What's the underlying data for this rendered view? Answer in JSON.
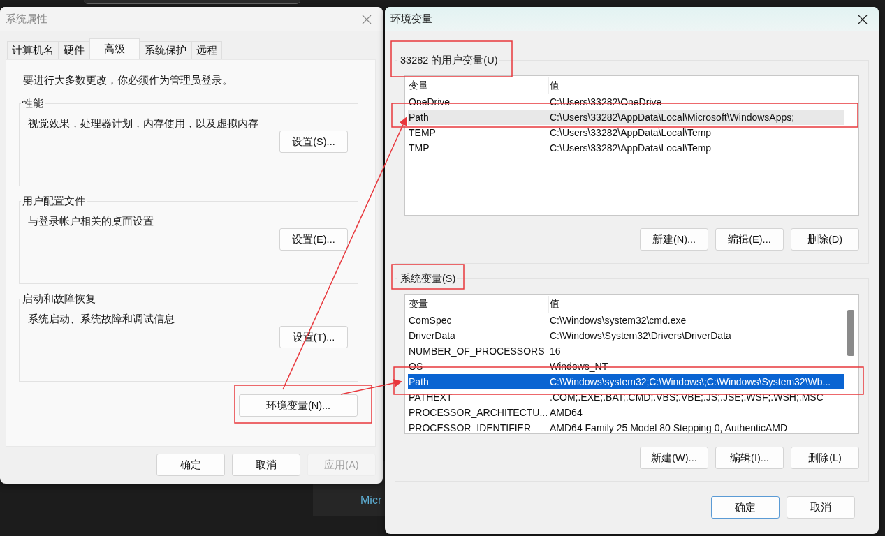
{
  "background": {
    "texts": [
      "Micr"
    ]
  },
  "system_properties": {
    "title": "系统属性",
    "active": false,
    "tabs": [
      {
        "label": "计算机名",
        "selected": false
      },
      {
        "label": "硬件",
        "selected": false
      },
      {
        "label": "高级",
        "selected": true
      },
      {
        "label": "系统保护",
        "selected": false
      },
      {
        "label": "远程",
        "selected": false
      }
    ],
    "notice": "要进行大多数更改，你必须作为管理员登录。",
    "groups": [
      {
        "legend": "性能",
        "description": "视觉效果，处理器计划，内存使用，以及虚拟内存",
        "button": "设置(S)..."
      },
      {
        "legend": "用户配置文件",
        "description": "与登录帐户相关的桌面设置",
        "button": "设置(E)..."
      },
      {
        "legend": "启动和故障恢复",
        "description": "系统启动、系统故障和调试信息",
        "button": "设置(T)..."
      }
    ],
    "env_button": "环境变量(N)...",
    "buttons": [
      {
        "label": "确定",
        "disabled": false
      },
      {
        "label": "取消",
        "disabled": false
      },
      {
        "label": "应用(A)",
        "disabled": true
      }
    ]
  },
  "environment_variables": {
    "title": "环境变量",
    "sections": [
      {
        "legend": "33282 的用户变量(U)",
        "focused": false,
        "columns": [
          "变量",
          "值"
        ],
        "rows": [
          {
            "name": "OneDrive",
            "value": "C:\\Users\\33282\\OneDrive",
            "selected": false
          },
          {
            "name": "Path",
            "value": "C:\\Users\\33282\\AppData\\Local\\Microsoft\\WindowsApps;",
            "selected": true
          },
          {
            "name": "TEMP",
            "value": "C:\\Users\\33282\\AppData\\Local\\Temp",
            "selected": false
          },
          {
            "name": "TMP",
            "value": "C:\\Users\\33282\\AppData\\Local\\Temp",
            "selected": false
          }
        ],
        "scrollbar": false,
        "buttons": [
          "新建(N)...",
          "编辑(E)...",
          "删除(D)"
        ]
      },
      {
        "legend": "系统变量(S)",
        "focused": true,
        "columns": [
          "变量",
          "值"
        ],
        "rows": [
          {
            "name": "ComSpec",
            "value": "C:\\Windows\\system32\\cmd.exe",
            "selected": false
          },
          {
            "name": "DriverData",
            "value": "C:\\Windows\\System32\\Drivers\\DriverData",
            "selected": false
          },
          {
            "name": "NUMBER_OF_PROCESSORS",
            "value": "16",
            "selected": false
          },
          {
            "name": "OS",
            "value": "Windows_NT",
            "selected": false
          },
          {
            "name": "Path",
            "value": "C:\\Windows\\system32;C:\\Windows\\;C:\\Windows\\System32\\Wb...",
            "selected": true
          },
          {
            "name": "PATHEXT",
            "value": ".COM;.EXE;.BAT;.CMD;.VBS;.VBE;.JS;.JSE;.WSF;.WSH;.MSC",
            "selected": false
          },
          {
            "name": "PROCESSOR_ARCHITECTU...",
            "value": "AMD64",
            "selected": false
          },
          {
            "name": "PROCESSOR_IDENTIFIER",
            "value": "AMD64 Family 25 Model 80 Stepping 0, AuthenticAMD",
            "selected": false
          }
        ],
        "scrollbar": true,
        "buttons": [
          "新建(W)...",
          "编辑(I)...",
          "删除(L)"
        ]
      }
    ],
    "buttons": [
      {
        "label": "确定",
        "default": true
      },
      {
        "label": "取消",
        "default": false
      }
    ]
  }
}
